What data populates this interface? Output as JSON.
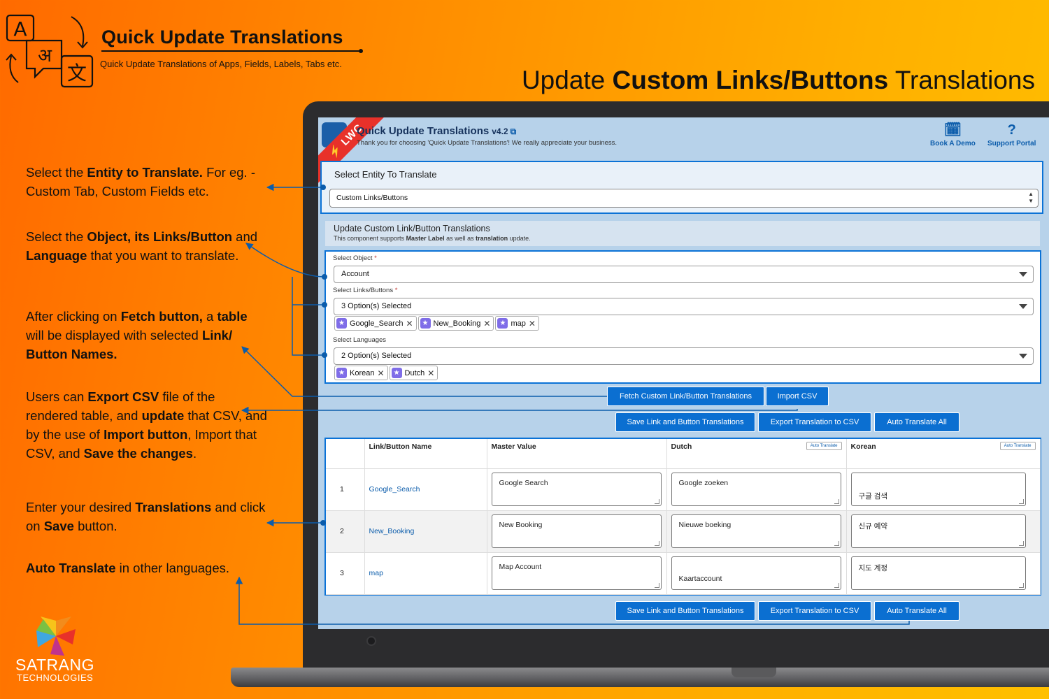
{
  "brand": {
    "title": "Quick Update Translations",
    "subtitle": "Quick Update Translations of Apps, Fields, Labels, Tabs etc.",
    "logo_glyphs": {
      "latin": "A",
      "devanagari": "अ",
      "cjk": "文"
    }
  },
  "hero": {
    "prefix": "Update",
    "bold": "Custom Links/Buttons",
    "suffix": "Translations"
  },
  "descriptions": [
    {
      "segments": [
        {
          "t": "Select the "
        },
        {
          "t": "Entity to Translate.",
          "b": true
        },
        {
          "t": " For eg. - Custom Tab, Custom Fields etc."
        }
      ]
    },
    {
      "segments": [
        {
          "t": "Select the "
        },
        {
          "t": "Object, its Links/Button",
          "b": true
        },
        {
          "t": " and "
        },
        {
          "t": "Language",
          "b": true
        },
        {
          "t": " that you want to translate."
        }
      ]
    },
    {
      "segments": [
        {
          "t": "After clicking on "
        },
        {
          "t": "Fetch button,",
          "b": true
        },
        {
          "t": " a "
        },
        {
          "t": "table",
          "b": true
        },
        {
          "t": " will be displayed with selected "
        },
        {
          "t": "Link/ Button Names.",
          "b": true
        }
      ]
    },
    {
      "segments": [
        {
          "t": "Users can "
        },
        {
          "t": "Export CSV",
          "b": true
        },
        {
          "t": " file of the rendered table, and "
        },
        {
          "t": "update",
          "b": true
        },
        {
          "t": " that CSV, and by the use of "
        },
        {
          "t": "Import button",
          "b": true
        },
        {
          "t": ", Import that CSV, and "
        },
        {
          "t": "Save the changes",
          "b": true
        },
        {
          "t": "."
        }
      ]
    },
    {
      "segments": [
        {
          "t": "Enter your desired "
        },
        {
          "t": "Translations",
          "b": true
        },
        {
          "t": " and click on "
        },
        {
          "t": "Save",
          "b": true
        },
        {
          "t": " button."
        }
      ]
    },
    {
      "segments": [
        {
          "t": "Auto Translate",
          "b": true
        },
        {
          "t": " in other languages."
        }
      ]
    }
  ],
  "app": {
    "ribbon": "LWC",
    "title": "Quick Update Translations",
    "version": "v4.2",
    "thanks": "Thank you for choosing 'Quick Update Translations'! We really appreciate your business.",
    "book_demo": "Book A Demo",
    "support_portal": "Support Portal",
    "entity": {
      "title": "Select Entity To Translate",
      "value": "Custom Links/Buttons"
    },
    "update": {
      "title": "Update Custom Link/Button Translations",
      "sub_prefix": "This component supports ",
      "sub_b1": "Master Label",
      "sub_mid": " as well as ",
      "sub_b2": "translation",
      "sub_suffix": " update."
    },
    "form": {
      "object_label": "Select Object",
      "object_value": "Account",
      "links_label": "Select Links/Buttons",
      "links_value": "3 Option(s) Selected",
      "links_pills": [
        "Google_Search",
        "New_Booking",
        "map"
      ],
      "lang_label": "Select Languages",
      "lang_value": "2 Option(s) Selected",
      "lang_pills": [
        "Korean",
        "Dutch"
      ],
      "required_mark": "*"
    },
    "buttons": {
      "fetch": "Fetch Custom Link/Button Translations",
      "import": "Import CSV",
      "save": "Save Link and Button Translations",
      "export": "Export Translation to CSV",
      "auto_all": "Auto Translate All"
    },
    "table": {
      "headers": [
        "",
        "Link/Button Name",
        "Master Value",
        "Dutch",
        "Korean"
      ],
      "auto_translate": "Auto Translate",
      "rows": [
        {
          "num": "1",
          "name": "Google_Search",
          "master": "Google Search",
          "dutch": "Google zoeken",
          "korean": "구글 검색"
        },
        {
          "num": "2",
          "name": "New_Booking",
          "master": "New Booking",
          "dutch": "Nieuwe boeking",
          "korean": "신규 예약"
        },
        {
          "num": "3",
          "name": "map",
          "master": "Map Account",
          "dutch": "Kaartaccount",
          "korean": "지도 계정"
        }
      ]
    }
  },
  "company": {
    "name": "SATRANG",
    "sub": "TECHNOLOGIES"
  },
  "colors": {
    "accent": "#0b6fd1",
    "ribbon": "#e8312a",
    "header_bg": "#b7d2ea"
  }
}
